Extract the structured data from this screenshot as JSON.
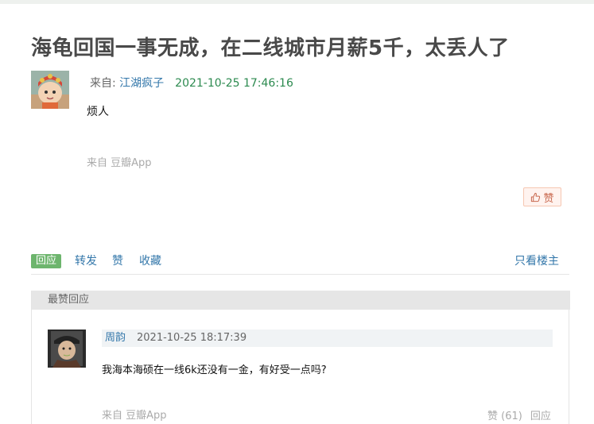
{
  "topic": {
    "title": "海龟回国一事无成，在二线城市月薪5千，太丢人了",
    "from_label": "来自: ",
    "author": "江湖疯子",
    "time": "2021-10-25 17:46:16",
    "content": "烦人",
    "source": "来自 豆瓣App",
    "like_label": "赞"
  },
  "actions": {
    "reply": "回应",
    "repost": "转发",
    "like": "赞",
    "collect": "收藏",
    "op_only": "只看楼主"
  },
  "top_replies": {
    "header": "最赞回应",
    "items": [
      {
        "author": "周韵",
        "time": "2021-10-25 18:17:39",
        "content": "我海本海硕在一线6k还没有一金，有好受一点吗?",
        "source": "来自 豆瓣App",
        "like_label": "赞 (61)",
        "reply_label": "回应"
      }
    ]
  },
  "colors": {
    "link": "#3377aa",
    "time_green": "#2c8a4f",
    "reply_button": "#6db56d",
    "like_button_text": "#c96a50"
  }
}
